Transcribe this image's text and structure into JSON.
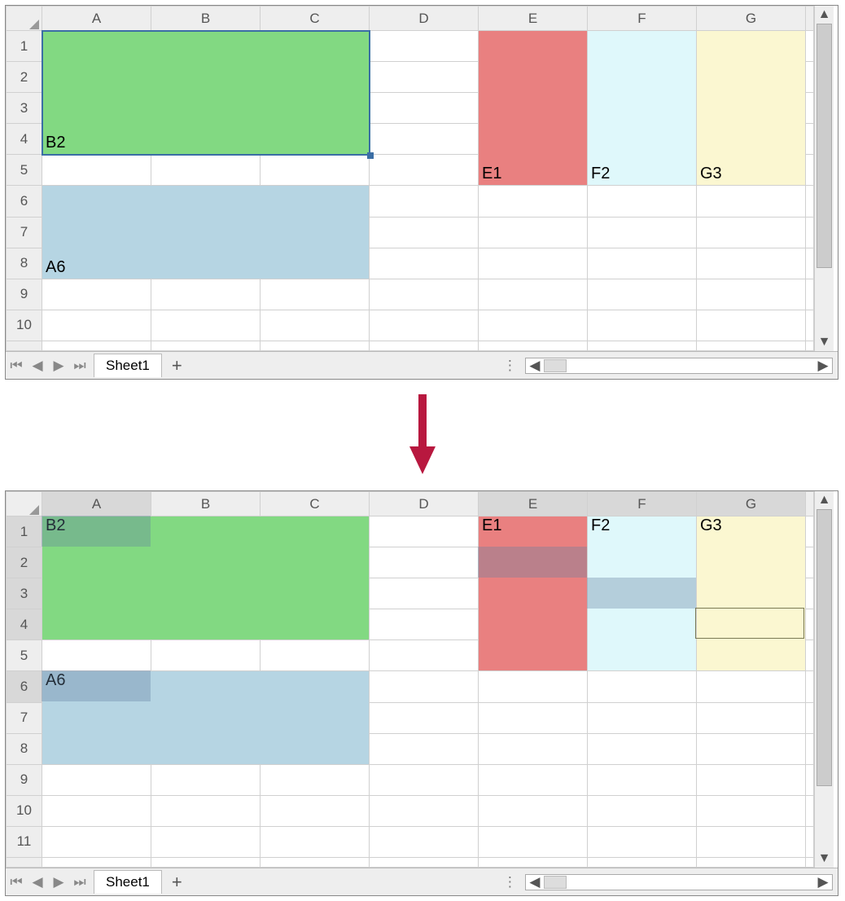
{
  "sheet_tab": "Sheet1",
  "top": {
    "columns": [
      "A",
      "B",
      "C",
      "D",
      "E",
      "F",
      "G"
    ],
    "rows": [
      "1",
      "2",
      "3",
      "4",
      "5",
      "6",
      "7",
      "8",
      "9",
      "10"
    ],
    "cells": {
      "B2_in_A4": "B2",
      "E1_in_E5": "E1",
      "F2_in_F5": "F2",
      "G3_in_G5": "G3",
      "A6_in_A8": "A6"
    },
    "merges": [
      {
        "id": "green",
        "r1": 1,
        "c1": 1,
        "r2": 4,
        "c2": 3,
        "color": "#82d982",
        "textKey": "B2_in_A4",
        "selected": true
      },
      {
        "id": "redE",
        "r1": 1,
        "c1": 5,
        "r2": 5,
        "c2": 5,
        "color": "#e98080",
        "textKey": "E1_in_E5"
      },
      {
        "id": "cyanF",
        "r1": 1,
        "c1": 6,
        "r2": 5,
        "c2": 6,
        "color": "#dff8fb",
        "textKey": "F2_in_F5"
      },
      {
        "id": "yelG",
        "r1": 1,
        "c1": 7,
        "r2": 5,
        "c2": 7,
        "color": "#fbf7d1",
        "textKey": "G3_in_G5"
      },
      {
        "id": "blueA6",
        "r1": 6,
        "c1": 1,
        "r2": 8,
        "c2": 3,
        "color": "#b6d5e3",
        "textKey": "A6_in_A8"
      }
    ]
  },
  "bottom": {
    "columns": [
      "A",
      "B",
      "C",
      "D",
      "E",
      "F",
      "G"
    ],
    "rows": [
      "1",
      "2",
      "3",
      "4",
      "5",
      "6",
      "7",
      "8",
      "9",
      "10",
      "11"
    ],
    "cells": {
      "B2_in_A1": "B2",
      "E1_in_E1": "E1",
      "F2_in_F1": "F2",
      "G3_in_G1": "G3",
      "A6_in_A6": "A6"
    },
    "merges": [
      {
        "id": "green",
        "r1": 1,
        "c1": 1,
        "r2": 4,
        "c2": 3,
        "color": "#82d982",
        "textKey": "B2_in_A1",
        "textAt": "top"
      },
      {
        "id": "redE",
        "r1": 1,
        "c1": 5,
        "r2": 5,
        "c2": 5,
        "color": "#e98080",
        "textKey": "E1_in_E1",
        "textAt": "top"
      },
      {
        "id": "cyanF",
        "r1": 1,
        "c1": 6,
        "r2": 5,
        "c2": 6,
        "color": "#dff8fb",
        "textKey": "F2_in_F1",
        "textAt": "top"
      },
      {
        "id": "yelG",
        "r1": 1,
        "c1": 7,
        "r2": 5,
        "c2": 7,
        "color": "#fbf7d1",
        "textKey": "G3_in_G1",
        "textAt": "top"
      },
      {
        "id": "blueA6",
        "r1": 6,
        "c1": 1,
        "r2": 8,
        "c2": 3,
        "color": "#b6d5e3",
        "textKey": "A6_in_A6",
        "textAt": "top"
      }
    ],
    "selection_overlays": [
      {
        "r": 1,
        "c": 1,
        "label": "A1"
      },
      {
        "r": 2,
        "c": 5,
        "label": "E2"
      },
      {
        "r": 3,
        "c": 6,
        "label": "F3"
      },
      {
        "r": 6,
        "c": 1,
        "label": "A6(sel)"
      }
    ],
    "active_cell": {
      "r": 4,
      "c": 7
    }
  },
  "arrow_color": "#b8183f"
}
